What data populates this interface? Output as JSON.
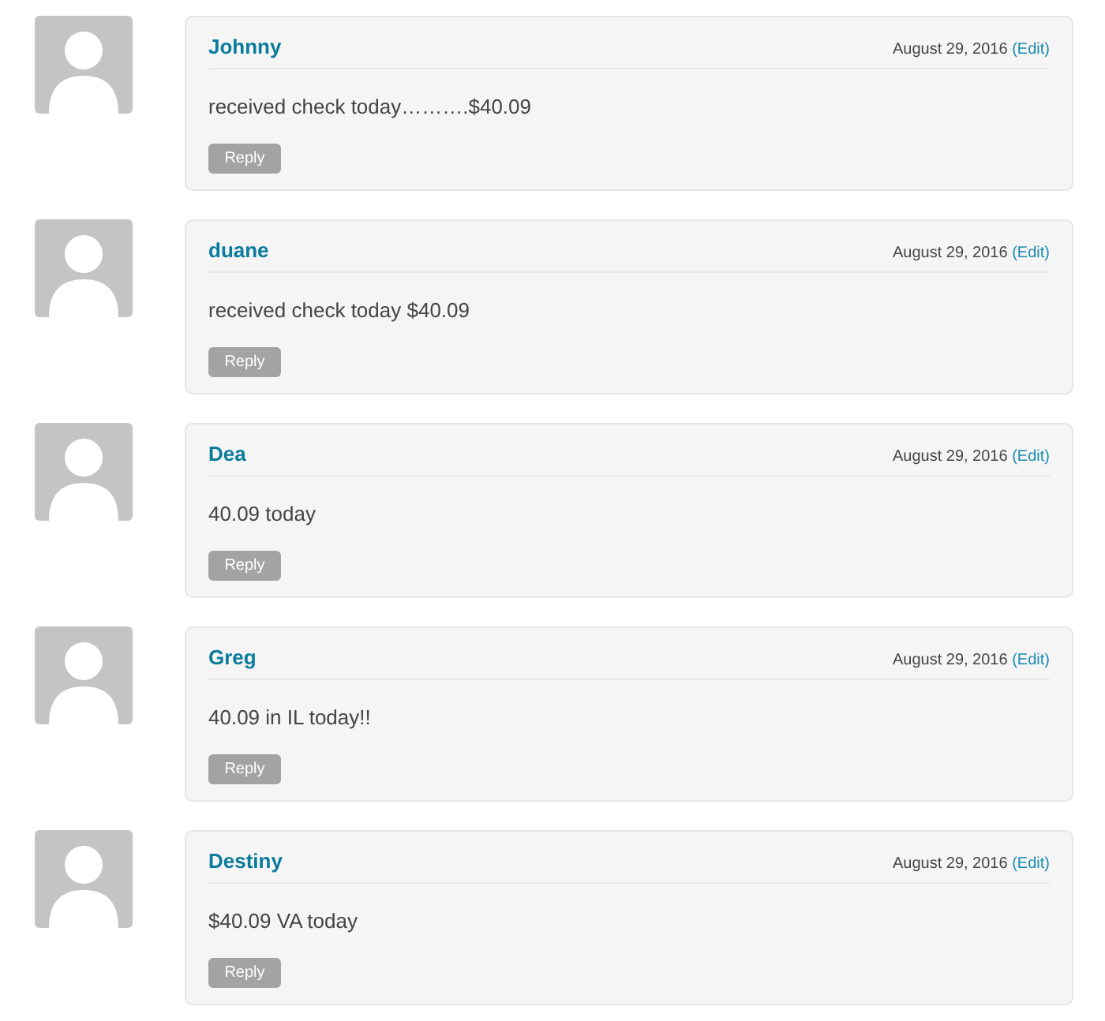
{
  "comments": [
    {
      "author": "Johnny",
      "date": "August 29, 2016",
      "edit": "(Edit)",
      "text": "received check today……….$40.09",
      "reply": "Reply"
    },
    {
      "author": "duane",
      "date": "August 29, 2016",
      "edit": "(Edit)",
      "text": "received check today $40.09",
      "reply": "Reply"
    },
    {
      "author": "Dea",
      "date": "August 29, 2016",
      "edit": "(Edit)",
      "text": "40.09 today",
      "reply": "Reply"
    },
    {
      "author": "Greg",
      "date": "August 29, 2016",
      "edit": "(Edit)",
      "text": "40.09 in IL today!!",
      "reply": "Reply"
    },
    {
      "author": "Destiny",
      "date": "August 29, 2016",
      "edit": "(Edit)",
      "text": "$40.09 VA today",
      "reply": "Reply"
    }
  ]
}
